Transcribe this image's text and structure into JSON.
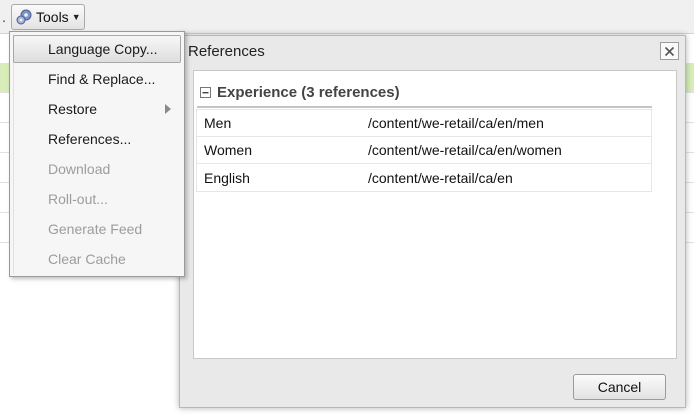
{
  "toolbar": {
    "overflow_text": ".",
    "tools_label": "Tools",
    "tools_icon": "gears-icon"
  },
  "menu": {
    "items": [
      {
        "label": "Language Copy...",
        "enabled": true,
        "highlighted": true,
        "submenu": false
      },
      {
        "label": "Find & Replace...",
        "enabled": true,
        "highlighted": false,
        "submenu": false
      },
      {
        "label": "Restore",
        "enabled": true,
        "highlighted": false,
        "submenu": true
      },
      {
        "label": "References...",
        "enabled": true,
        "highlighted": false,
        "submenu": false
      },
      {
        "label": "Download",
        "enabled": false,
        "highlighted": false,
        "submenu": false
      },
      {
        "label": "Roll-out...",
        "enabled": false,
        "highlighted": false,
        "submenu": false
      },
      {
        "label": "Generate Feed",
        "enabled": false,
        "highlighted": false,
        "submenu": false
      },
      {
        "label": "Clear Cache",
        "enabled": false,
        "highlighted": false,
        "submenu": false
      }
    ]
  },
  "dialog": {
    "title": "References",
    "group": {
      "title": "Experience (3 references)",
      "expanded": true,
      "rows": [
        {
          "name": "Men",
          "path": "/content/we-retail/ca/en/men"
        },
        {
          "name": "Women",
          "path": "/content/we-retail/ca/en/women"
        },
        {
          "name": "English",
          "path": "/content/we-retail/ca/en"
        }
      ]
    },
    "cancel_label": "Cancel"
  },
  "colors": {
    "selected_row": "#d8edba",
    "menu_bg": "#f6f6f6",
    "dialog_bg": "#e9e9e9",
    "disabled_text": "#9c9c9c"
  }
}
